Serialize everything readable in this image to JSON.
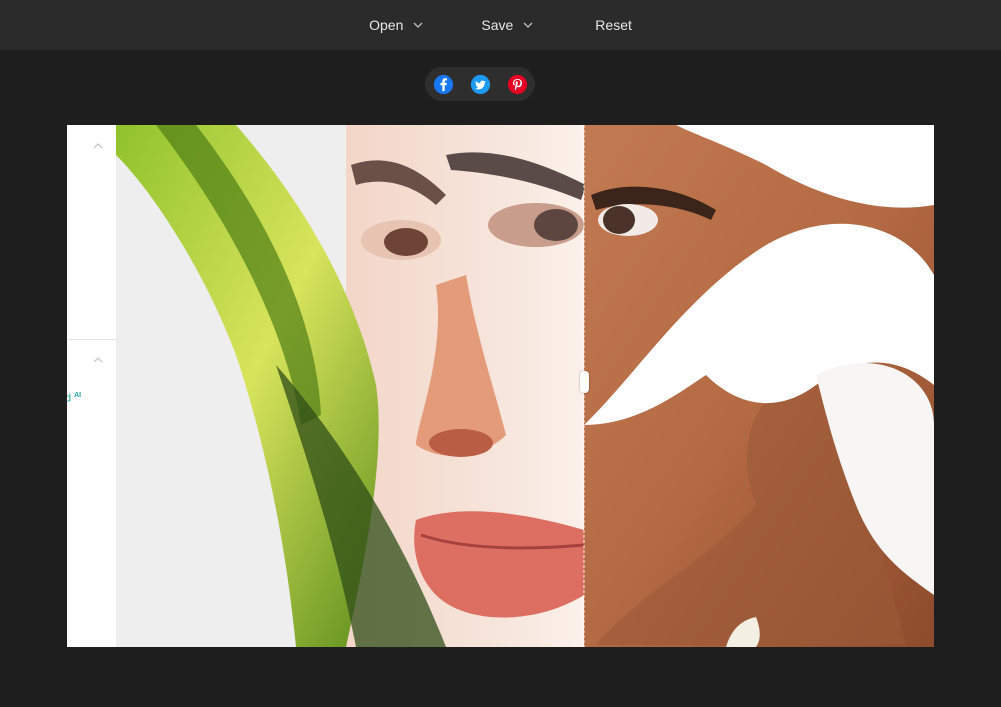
{
  "toolbar": {
    "open_label": "Open",
    "save_label": "Save",
    "reset_label": "Reset"
  },
  "share": {
    "facebook": {
      "icon": "facebook-icon",
      "color": "#1877f2"
    },
    "twitter": {
      "icon": "twitter-icon",
      "color": "#1d9bf0"
    },
    "pinterest": {
      "icon": "pinterest-icon",
      "color": "#e60023"
    }
  },
  "side_panel": {
    "ai_label_fragment": "d",
    "ai_badge": "AI"
  },
  "colors": {
    "background": "#1e1e1e",
    "toolbar": "#2b2b2b",
    "accent": "#2aa7a2"
  }
}
